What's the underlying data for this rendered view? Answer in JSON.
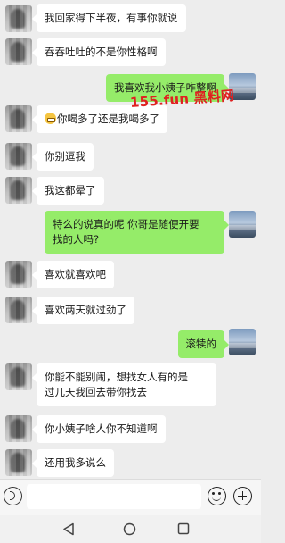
{
  "watermark": "155.fun 黑料网",
  "messages": [
    {
      "side": "left",
      "text": "我回家得下半夜，有事你就说"
    },
    {
      "side": "left",
      "text": "吞吞吐吐的不是你性格啊"
    },
    {
      "side": "right",
      "text": "我喜欢我小姨子咋整啊"
    },
    {
      "side": "left",
      "emoji": "grin-emoji",
      "text": "你喝多了还是我喝多了"
    },
    {
      "side": "left",
      "text": "你别逗我"
    },
    {
      "side": "left",
      "text": "我这都晕了"
    },
    {
      "side": "right",
      "text": "特么的说真的呢 你哥是随便开要\n找的人吗?"
    },
    {
      "side": "left",
      "text": "喜欢就喜欢吧"
    },
    {
      "side": "left",
      "text": "喜欢两天就过劲了"
    },
    {
      "side": "right",
      "text": "滚犊的"
    },
    {
      "side": "left",
      "text": "你能不能别闹，想找女人有的是\n过几天我回去带你找去"
    },
    {
      "side": "left",
      "text": "你小姨子啥人你不知道啊"
    },
    {
      "side": "left",
      "text": "还用我多说么"
    }
  ],
  "input": {
    "value": "",
    "placeholder": ""
  },
  "icons": {
    "voice": "voice-icon",
    "emoji": "emoji-icon",
    "plus": "plus-icon",
    "nav_back": "back-triangle-icon",
    "nav_home": "home-circle-icon",
    "nav_recent": "recent-square-icon"
  },
  "colors": {
    "background": "#ededed",
    "incoming_bubble": "#ffffff",
    "outgoing_bubble": "#95ec69",
    "watermark": "#e02020"
  }
}
